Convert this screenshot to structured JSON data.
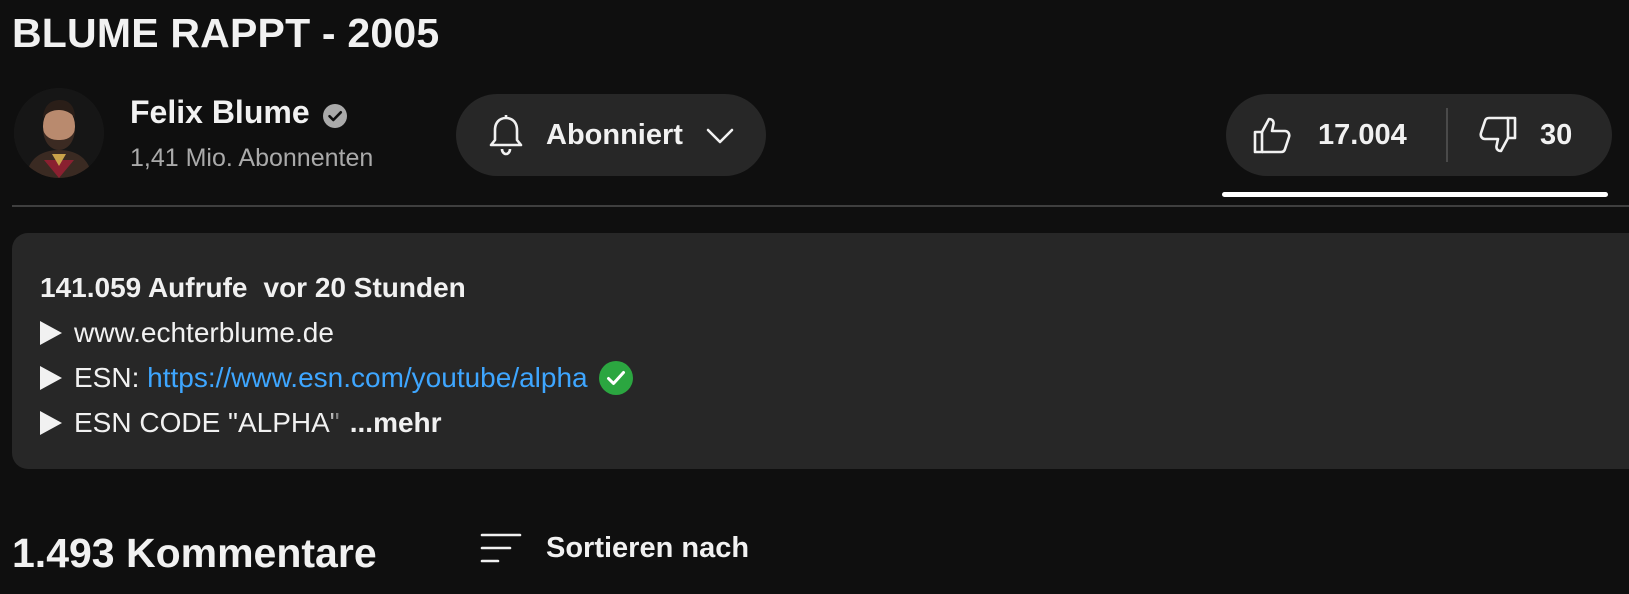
{
  "video": {
    "title": "BLUME RAPPT - 2005"
  },
  "channel": {
    "name": "Felix Blume",
    "subscribers": "1,41 Mio. Abonnenten",
    "avatar_icon": "person-avatar"
  },
  "subscribe": {
    "label": "Abonniert",
    "icon": "bell-icon",
    "dropdown_icon": "chevron-down-icon"
  },
  "actions": {
    "likes": "17.004",
    "dislikes": "30",
    "like_ratio": 0.998
  },
  "description": {
    "views": "141.059 Aufrufe",
    "published": "vor 20 Stunden",
    "lines": [
      {
        "text": "www.echterblume.de"
      },
      {
        "prefix": "ESN: ",
        "link": "https://www.esn.com/youtube/alpha"
      },
      {
        "text_main": "ESN CODE \"ALPH",
        "text_fade": "A\""
      }
    ],
    "more_label": "...mehr"
  },
  "comments": {
    "count_label": "1.493 Kommentare",
    "sort_label": "Sortieren nach"
  },
  "colors": {
    "background": "#0f0f0f",
    "surface": "#272727",
    "link": "#3ea6ff",
    "verified_green": "#2ba640"
  }
}
